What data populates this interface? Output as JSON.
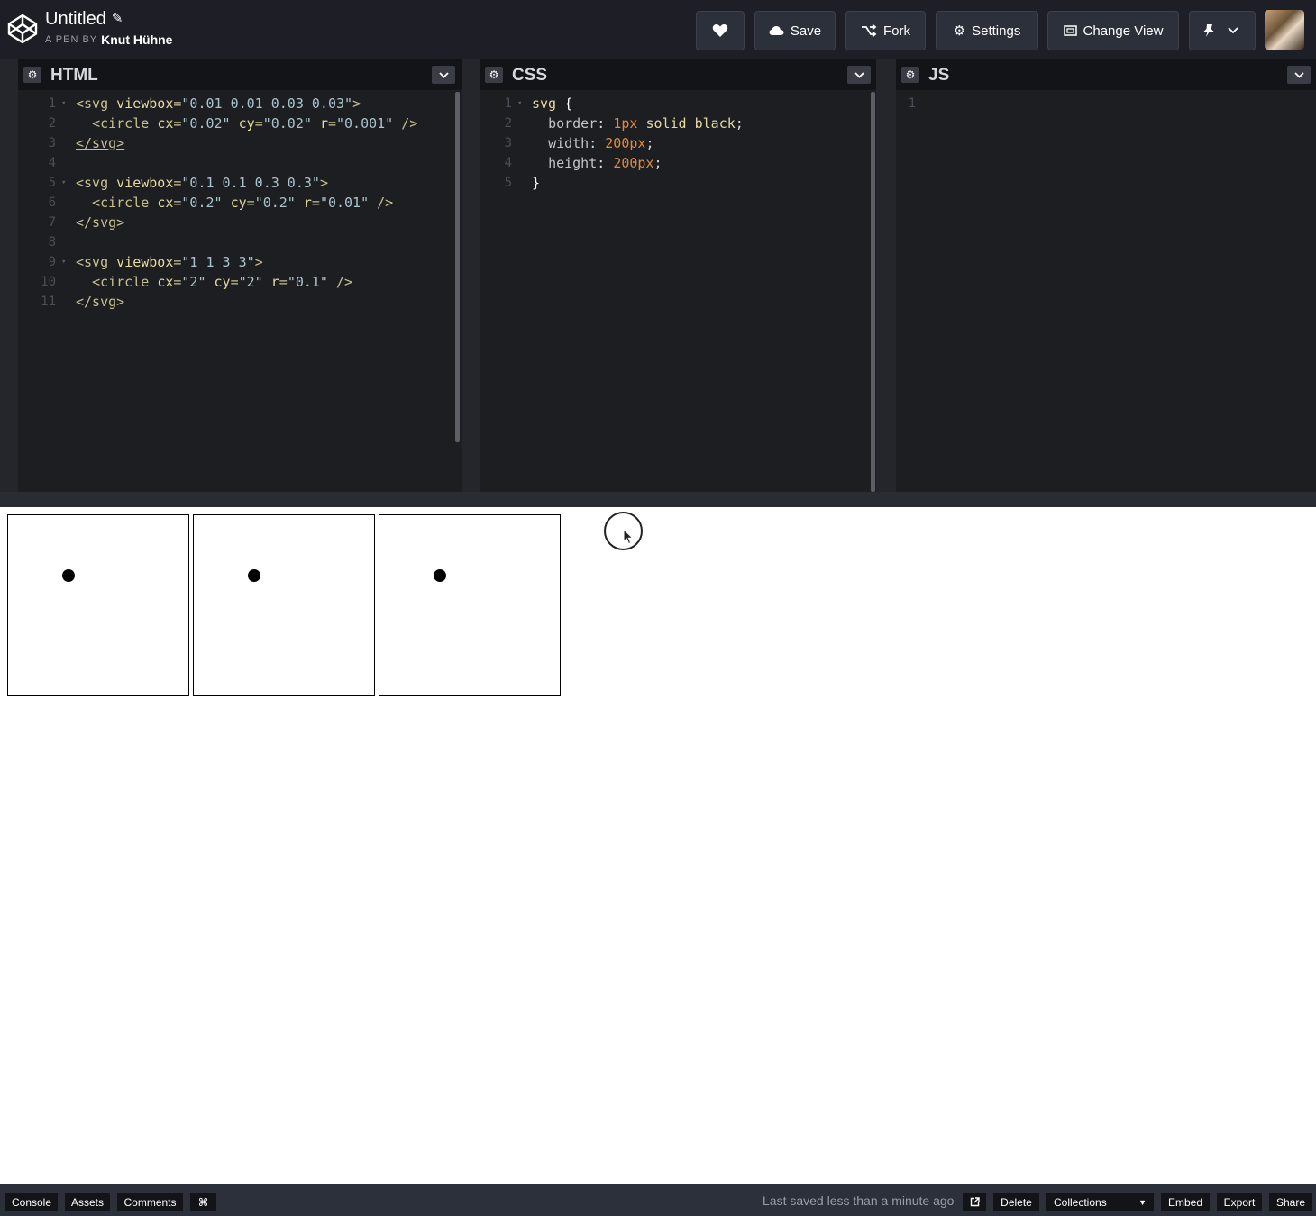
{
  "header": {
    "title": "Untitled",
    "by_label": "A PEN BY",
    "author": "Knut Hühne",
    "buttons": {
      "love_icon": "heart-icon",
      "save_label": "Save",
      "fork_label": "Fork",
      "settings_label": "Settings",
      "change_view_label": "Change View"
    }
  },
  "editors": {
    "html": {
      "title": "HTML",
      "line_numbers": [
        "1",
        "2",
        "3",
        "4",
        "5",
        "6",
        "7",
        "8",
        "9",
        "10",
        "11"
      ],
      "lines": [
        "<svg viewbox=\"0.01 0.01 0.03 0.03\">",
        "  <circle cx=\"0.02\" cy=\"0.02\" r=\"0.001\" />",
        "</svg>",
        "",
        "<svg viewbox=\"0.1 0.1 0.3 0.3\">",
        "  <circle cx=\"0.2\" cy=\"0.2\" r=\"0.01\" />",
        "</svg>",
        "",
        "<svg viewbox=\"1 1 3 3\">",
        "  <circle cx=\"2\" cy=\"2\" r=\"0.1\" />",
        "</svg>"
      ]
    },
    "css": {
      "title": "CSS",
      "line_numbers": [
        "1",
        "2",
        "3",
        "4",
        "5"
      ],
      "lines": [
        "svg {",
        "  border: 1px solid black;",
        "  width: 200px;",
        "  height: 200px;",
        "}"
      ]
    },
    "js": {
      "title": "JS",
      "line_numbers": [
        "1"
      ],
      "lines": [
        ""
      ]
    }
  },
  "footer": {
    "console_label": "Console",
    "assets_label": "Assets",
    "comments_label": "Comments",
    "shortcut_label": "⌘",
    "saved_status": "Last saved less than a minute ago",
    "delete_label": "Delete",
    "collections_label": "Collections",
    "embed_label": "Embed",
    "export_label": "Export",
    "share_label": "Share"
  },
  "colors": {
    "header_bg": "#1e1f26",
    "editor_bg": "#1d1e22",
    "footer_bg": "#2c303a",
    "number_color": "#e08a3c"
  }
}
